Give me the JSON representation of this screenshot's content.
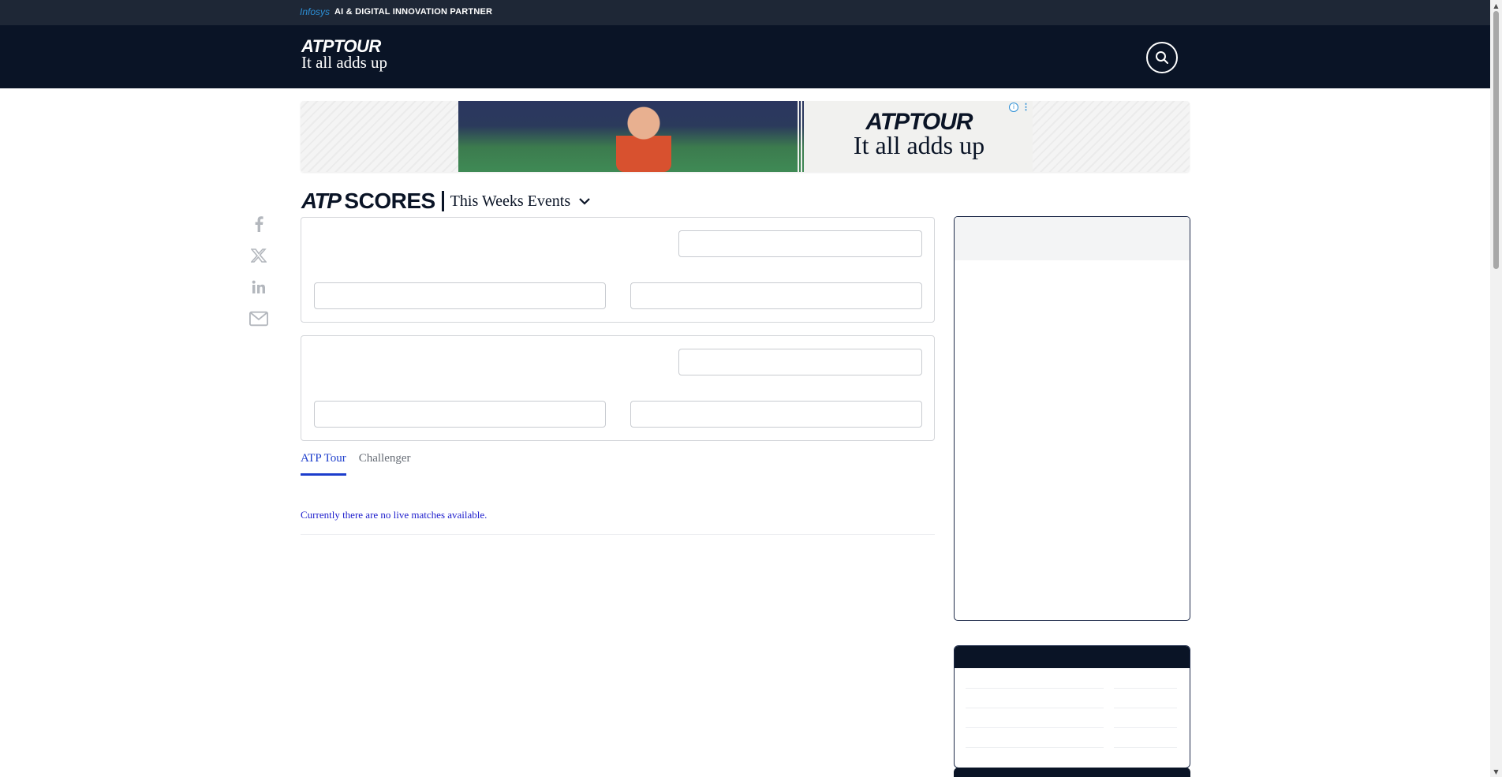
{
  "partner_bar": {
    "brand": "Infosys",
    "text": "AI & DIGITAL INNOVATION PARTNER"
  },
  "header": {
    "logo_main": "ATPTOUR",
    "logo_tagline": "It all adds up",
    "search_icon": "search-icon"
  },
  "ad": {
    "logo_main": "ATPTOUR",
    "logo_tagline": "It all adds up",
    "info_glyph": "i",
    "more_glyph": "⋮"
  },
  "share": {
    "icons": [
      "facebook-icon",
      "x-icon",
      "linkedin-icon",
      "email-icon"
    ]
  },
  "scores": {
    "brand": "ATP",
    "title": "SCORES",
    "dropdown_label": "This Weeks Events",
    "dropdown_icon": "chevron-down-icon"
  },
  "tabs": [
    {
      "label": "ATP Tour",
      "active": true
    },
    {
      "label": "Challenger",
      "active": false
    }
  ],
  "live": {
    "empty_message": "Currently there are no live matches available."
  },
  "colors": {
    "navy": "#0a1426",
    "accent_blue": "#1c3dcc",
    "partner_bg": "#1e2736"
  },
  "scrollbar": {
    "up_glyph": "▲",
    "down_glyph": "▼"
  }
}
